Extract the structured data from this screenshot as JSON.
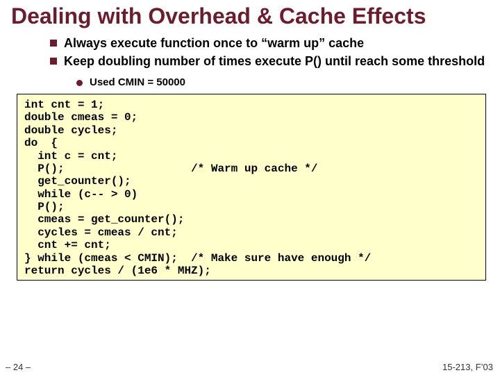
{
  "title": "Dealing with Overhead & Cache Effects",
  "bullets": [
    "Always execute function once to “warm up” cache",
    "Keep doubling number of times execute P() until reach some threshold"
  ],
  "subbullet": "Used CMIN = 50000",
  "code": "int cnt = 1;\ndouble cmeas = 0;\ndouble cycles;\ndo  {\n  int c = cnt;\n  P();                   /* Warm up cache */\n  get_counter();\n  while (c-- > 0)\n  P();\n  cmeas = get_counter();\n  cycles = cmeas / cnt;\n  cnt += cnt;\n} while (cmeas < CMIN);  /* Make sure have enough */\nreturn cycles / (1e6 * MHZ);",
  "footer_left": "– 24 –",
  "footer_right": "15-213, F’03"
}
